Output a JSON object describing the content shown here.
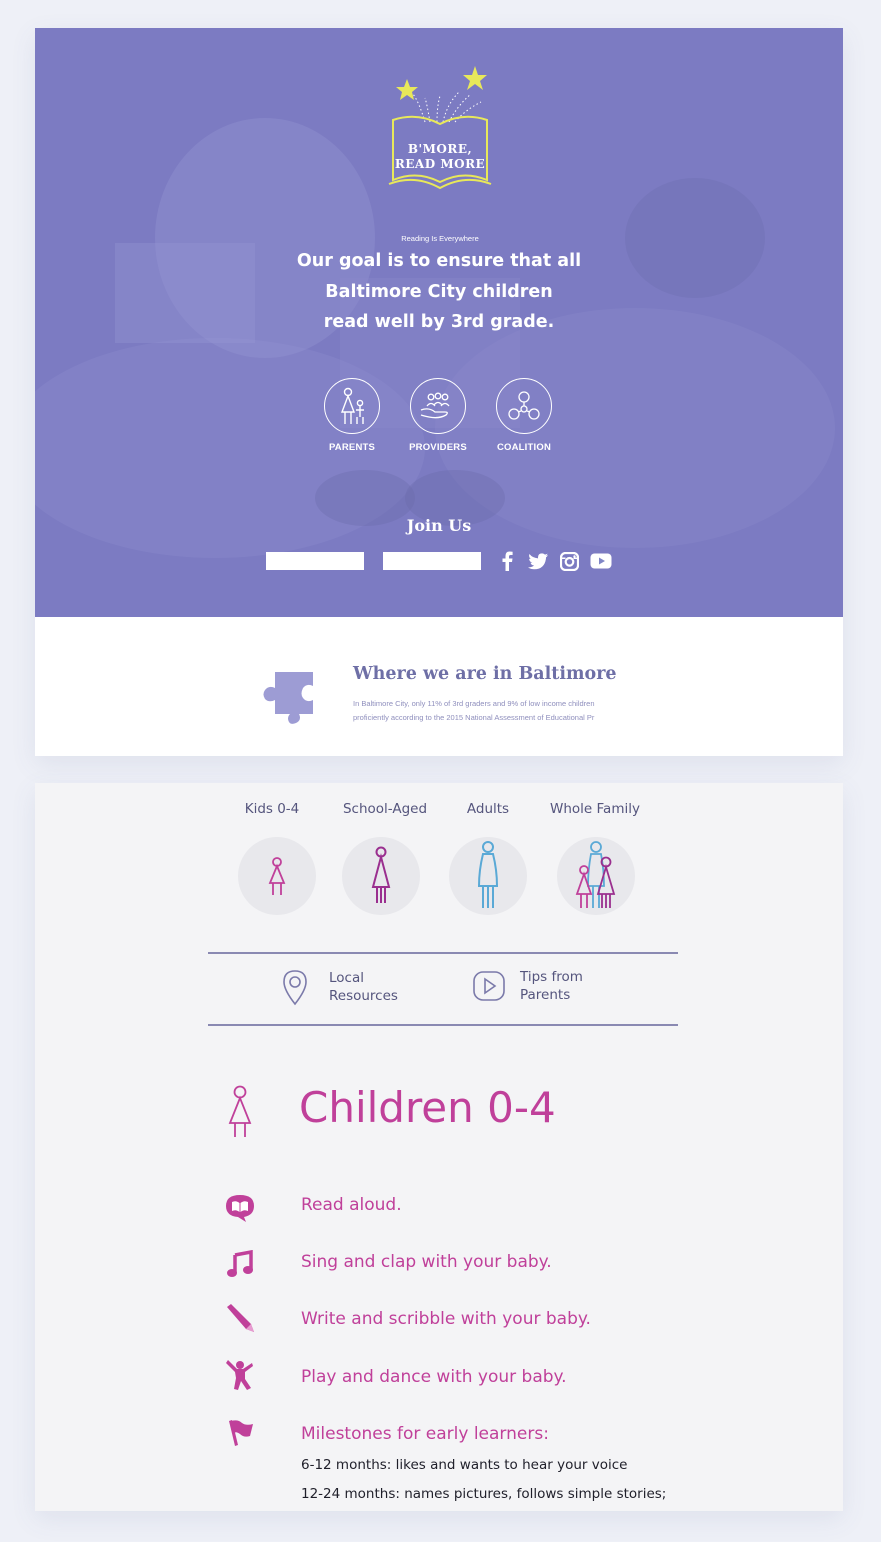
{
  "brand": {
    "logo_line1": "B'MORE,",
    "logo_line2": "READ MORE",
    "tagline": "Reading Is Everywhere"
  },
  "hero": {
    "goal_line1": "Our goal is to ensure that all",
    "goal_line2": "Baltimore City children",
    "goal_line3": "read well by 3rd grade."
  },
  "audiences": [
    {
      "label": "PARENTS",
      "icon": "parent-child-icon"
    },
    {
      "label": "PROVIDERS",
      "icon": "hands-group-icon"
    },
    {
      "label": "COALITION",
      "icon": "coalition-rings-icon"
    }
  ],
  "join": {
    "title": "Join Us",
    "social": [
      "facebook-icon",
      "twitter-icon",
      "instagram-icon",
      "youtube-icon"
    ]
  },
  "baltimore": {
    "title": "Where we are in Baltimore",
    "text_line1": "In Baltimore City, only 11% of 3rd graders and 9% of low income children",
    "text_line2": "proficiently according to the 2015 National Assessment of Educational Pr"
  },
  "age_tabs": [
    {
      "label": "Kids 0-4",
      "icon": "child-icon"
    },
    {
      "label": "School-Aged",
      "icon": "child-icon"
    },
    {
      "label": "Adults",
      "icon": "adult-icon"
    },
    {
      "label": "Whole Family",
      "icon": "family-icon"
    }
  ],
  "resources": [
    {
      "label_line1": "Local",
      "label_line2": "Resources",
      "icon": "map-pin-icon"
    },
    {
      "label_line1": "Tips from",
      "label_line2": "Parents",
      "icon": "play-icon"
    }
  ],
  "section": {
    "title": "Children 0-4",
    "tips": [
      {
        "text": "Read aloud.",
        "icon": "book-bubble-icon"
      },
      {
        "text": "Sing and clap with your baby.",
        "icon": "music-note-icon"
      },
      {
        "text": "Write and scribble with your baby.",
        "icon": "pencil-icon"
      },
      {
        "text": "Play and dance with your baby.",
        "icon": "dancing-figure-icon"
      },
      {
        "text": "Milestones for early learners:",
        "icon": "flag-icon"
      }
    ],
    "milestones": [
      "6-12 months: likes and wants to hear your voice",
      "12-24 months: names pictures, follows simple stories;"
    ]
  },
  "colors": {
    "hero_purple": "#7d7cc3",
    "logo_yellow": "#e8e85a",
    "accent_magenta": "#c0409a",
    "kid_purple": "#9a2f8f",
    "adult_blue": "#5aa9d6",
    "navy_text": "#55557d",
    "puzzle_lilac": "#9d9cd4"
  }
}
